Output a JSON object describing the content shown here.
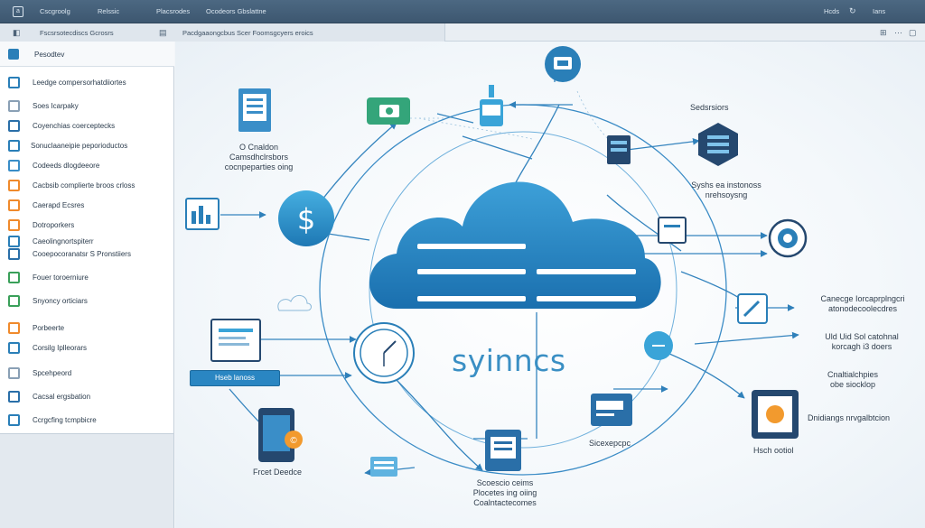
{
  "topbar": {
    "items": [
      "Cscgroolg",
      "Relssic",
      "Placsrodes",
      "Ocodeors Gbslattne"
    ],
    "right_items": [
      "Hcds",
      "Ians"
    ]
  },
  "subbar": {
    "left_label": "Fscsrsotecdiscs Gcrosrs",
    "right_label": "Pacdgaaongcbus Scer Foomsgcyers eroics"
  },
  "sidebar": {
    "header_label": "Pesodtev",
    "items": [
      {
        "label": "Leedge compersorhatdiiortes",
        "icon": "document-icon",
        "color": "#2a7fb8"
      },
      {
        "label": "Soes Icarpaky",
        "icon": "file-icon",
        "color": "#8aa0b5"
      },
      {
        "label": "Coyenchias coerceptecks",
        "icon": "tools-icon",
        "color": "#2a6fa8"
      },
      {
        "label": "Sonuclaaneipie peporioductos",
        "icon": "monitor-icon",
        "color": "#2a7fb8"
      },
      {
        "label": "Codeeds dlogdeeore",
        "icon": "database-icon",
        "color": "#3a8ec8"
      },
      {
        "label": "Cacbsib complierte broos crloss",
        "icon": "user-icon",
        "color": "#f08a2c"
      },
      {
        "label": "Caerapd Ecsres",
        "icon": "folder-icon",
        "color": "#f08a2c"
      },
      {
        "label": "Dotroporkers",
        "icon": "warning-icon",
        "color": "#f08a2c"
      },
      {
        "label": "Caeolingnortspiterr",
        "icon": "chart-icon",
        "color": "#2a7fb8"
      },
      {
        "label": "Cooepocoranatsr S Pronstiiers",
        "icon": "circle-icon",
        "color": "#2a6fa8"
      },
      {
        "label": "Fouer toroerniure",
        "icon": "monitor-icon",
        "color": "#3aa05a"
      },
      {
        "label": "Snyoncy orticiars",
        "icon": "leaf-icon",
        "color": "#3aa05a"
      },
      {
        "label": "Porbeerte",
        "icon": "book-icon",
        "color": "#f08a2c"
      },
      {
        "label": "Corsilg Iplleorars",
        "icon": "page-icon",
        "color": "#2a7fb8"
      },
      {
        "label": "Spcehpeord",
        "icon": "clipboard-icon",
        "color": "#8aa0b5"
      },
      {
        "label": "Cacsal ergsbation",
        "icon": "lock-icon",
        "color": "#2a6fa8"
      },
      {
        "label": "Ccrgcfing tcmpbicre",
        "icon": "gear-icon",
        "color": "#2a7fb8"
      }
    ]
  },
  "diagram": {
    "brand": "syinncs",
    "labels": {
      "top_left": "O Cnaldon\nCamsdhclrsbors\ncocnpeparties oing",
      "top_right": "Sedsrsiors",
      "mid_right": "Syshs ea instonoss\nnrehsoysng",
      "right_1": "Canecge Iorcaprplngcri\natonodecoolecdres",
      "right_2": "Uld Uid Sol catohnal\nkorcagh i3 doers",
      "right_3": "Cnaltialchpies\nobe siocklop",
      "right_4": "Dnidiangs nrvgalbtcion",
      "right_5": "Hsch ootiol",
      "bottom_center": "Scoescio ceims\nPlocetes ing oiing\nCoalntactecomes",
      "bottom_left": "Frcet Deedce",
      "bottom_mid": "Sicexepcpc",
      "left_button": "Hseb lanoss"
    },
    "colors": {
      "cloud": "#1f7fbf",
      "cloud_light": "#5fb3e0",
      "line": "#3b8cc6",
      "accent_orange": "#f29a2e",
      "accent_green": "#34a57a",
      "dark_navy": "#25486f"
    }
  }
}
